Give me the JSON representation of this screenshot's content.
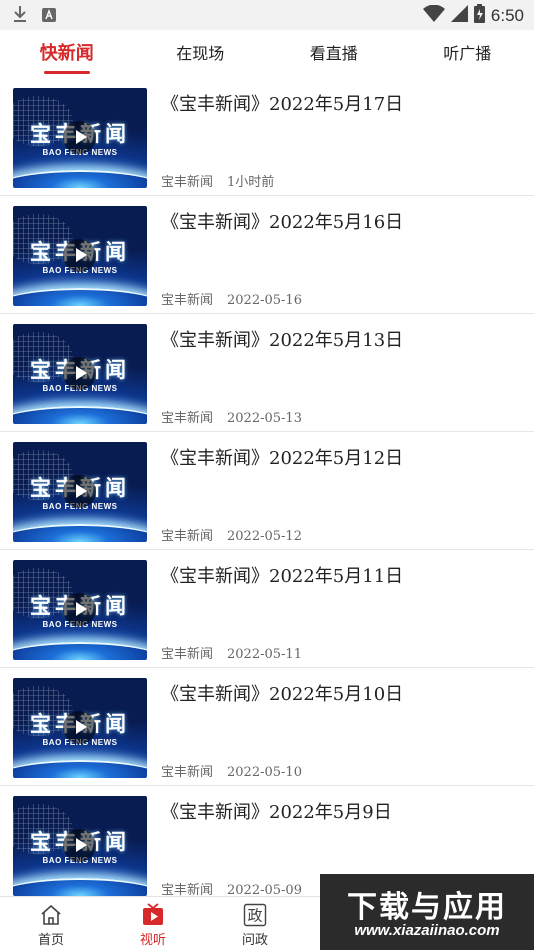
{
  "status_bar": {
    "time": "6:50",
    "left_icons": [
      "download-icon",
      "a-badge-icon"
    ],
    "right_icons": [
      "wifi-icon",
      "signal-icon",
      "battery-icon"
    ]
  },
  "tabs": [
    {
      "label": "快新闻",
      "active": true
    },
    {
      "label": "在现场",
      "active": false
    },
    {
      "label": "看直播",
      "active": false
    },
    {
      "label": "听广播",
      "active": false
    }
  ],
  "thumbnail": {
    "title_cn": "宝丰新闻",
    "title_en": "BAO FENG NEWS"
  },
  "news": [
    {
      "title": "《宝丰新闻》2022年5月17日",
      "source": "宝丰新闻",
      "time": "1小时前"
    },
    {
      "title": "《宝丰新闻》2022年5月16日",
      "source": "宝丰新闻",
      "time": "2022-05-16"
    },
    {
      "title": "《宝丰新闻》2022年5月13日",
      "source": "宝丰新闻",
      "time": "2022-05-13"
    },
    {
      "title": "《宝丰新闻》2022年5月12日",
      "source": "宝丰新闻",
      "time": "2022-05-12"
    },
    {
      "title": "《宝丰新闻》2022年5月11日",
      "source": "宝丰新闻",
      "time": "2022-05-11"
    },
    {
      "title": "《宝丰新闻》2022年5月10日",
      "source": "宝丰新闻",
      "time": "2022-05-10"
    },
    {
      "title": "《宝丰新闻》2022年5月9日",
      "source": "宝丰新闻",
      "time": "2022-05-09"
    }
  ],
  "bottom_nav": [
    {
      "label": "首页",
      "icon": "home-icon",
      "active": false
    },
    {
      "label": "视听",
      "icon": "video-play-icon",
      "active": true
    },
    {
      "label": "问政",
      "icon": "zheng-icon",
      "active": false
    }
  ],
  "bottom_nav_zheng_glyph": "政",
  "watermark": {
    "text": "下载与应用",
    "url": "www.xiazaiinao.com"
  },
  "colors": {
    "accent": "#d7282a",
    "status_bar_bg": "#f2f2f2",
    "divider": "#e6e6e6"
  }
}
